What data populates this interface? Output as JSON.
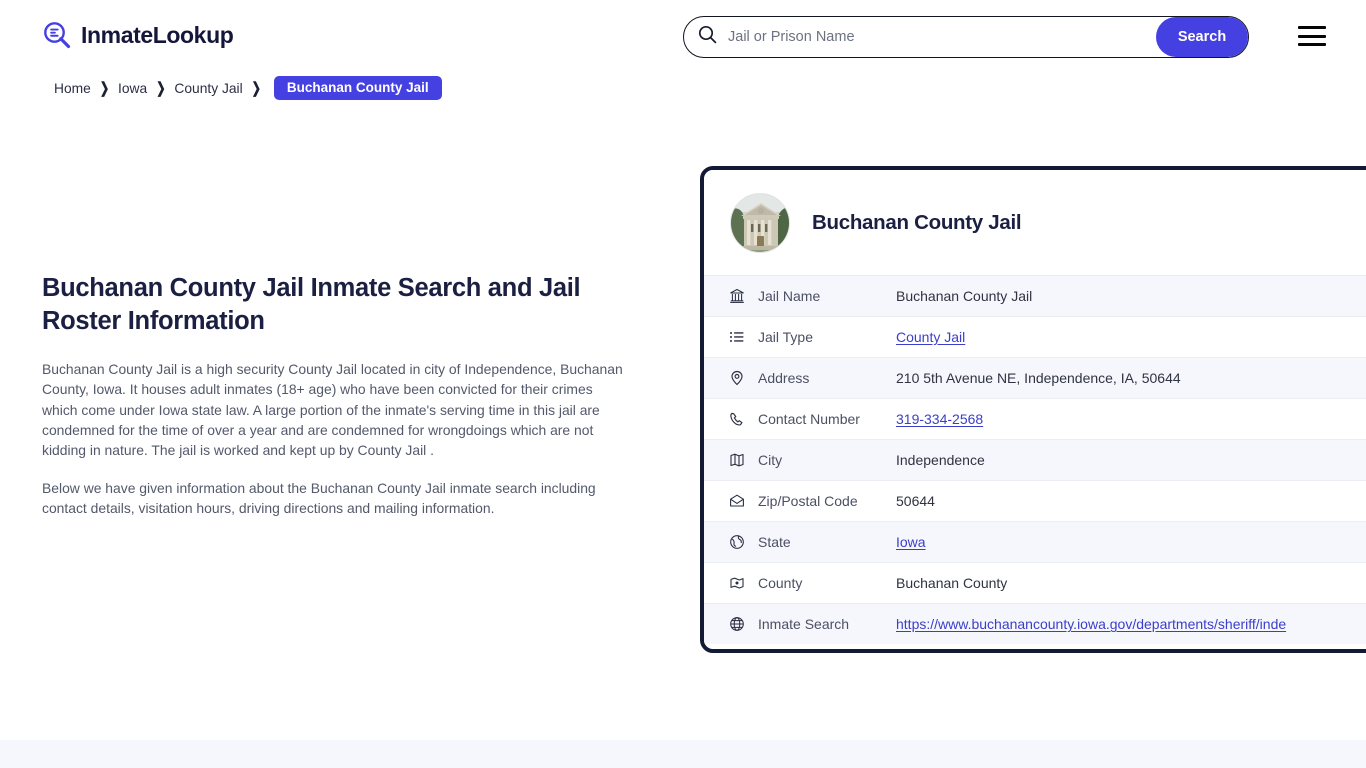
{
  "header": {
    "brand_name": "InmateLookup",
    "brand_icon": "magnifier-list-icon",
    "search": {
      "placeholder": "Jail or Prison Name",
      "value": "",
      "button_label": "Search",
      "icon": "search-icon"
    },
    "menu_icon": "hamburger-menu-icon"
  },
  "breadcrumb": {
    "items": [
      {
        "label": "Home"
      },
      {
        "label": "Iowa"
      },
      {
        "label": "County Jail"
      }
    ],
    "separator": "❯",
    "current": "Buchanan County Jail"
  },
  "main": {
    "title": "Buchanan County Jail Inmate Search and Jail Roster Information",
    "paragraph_1": "Buchanan County Jail is a high security County Jail located in city of Independence, Buchanan County, Iowa. It houses adult inmates (18+ age) who have been convicted for their crimes which come under Iowa state law. A large portion of the inmate's serving time in this jail are condemned for the time of over a year and are condemned for wrongdoings which are not kidding in nature. The jail is worked and kept up by County Jail .",
    "paragraph_2": "Below we have given information about the Buchanan County Jail inmate search including contact details, visitation hours, driving directions and mailing information."
  },
  "card": {
    "avatar_icon": "courthouse-building-photo",
    "title": "Buchanan County Jail",
    "rows": [
      {
        "icon": "bank-icon",
        "label": "Jail Name",
        "value": "Buchanan County Jail",
        "link": false
      },
      {
        "icon": "list-icon",
        "label": "Jail Type",
        "value": "County Jail",
        "link": true
      },
      {
        "icon": "map-pin-icon",
        "label": "Address",
        "value": "210 5th Avenue NE, Independence, IA, 50644",
        "link": false
      },
      {
        "icon": "phone-icon",
        "label": "Contact Number",
        "value": "319-334-2568",
        "link": true
      },
      {
        "icon": "map-icon",
        "label": "City",
        "value": "Independence",
        "link": false
      },
      {
        "icon": "envelope-icon",
        "label": "Zip/Postal Code",
        "value": "50644",
        "link": false
      },
      {
        "icon": "globe-grid-icon",
        "label": "State",
        "value": "Iowa",
        "link": true
      },
      {
        "icon": "county-map-icon",
        "label": "County",
        "value": "Buchanan County",
        "link": false
      },
      {
        "icon": "globe-icon",
        "label": "Inmate Search",
        "value": "https://www.buchanancounty.iowa.gov/departments/sheriff/inde",
        "link": true
      }
    ]
  },
  "colors": {
    "accent": "#4540e1",
    "link": "#3b3ec9",
    "dark_navy": "#131a35",
    "row_alt": "#f6f7fd",
    "band": "#f6f6fd"
  }
}
